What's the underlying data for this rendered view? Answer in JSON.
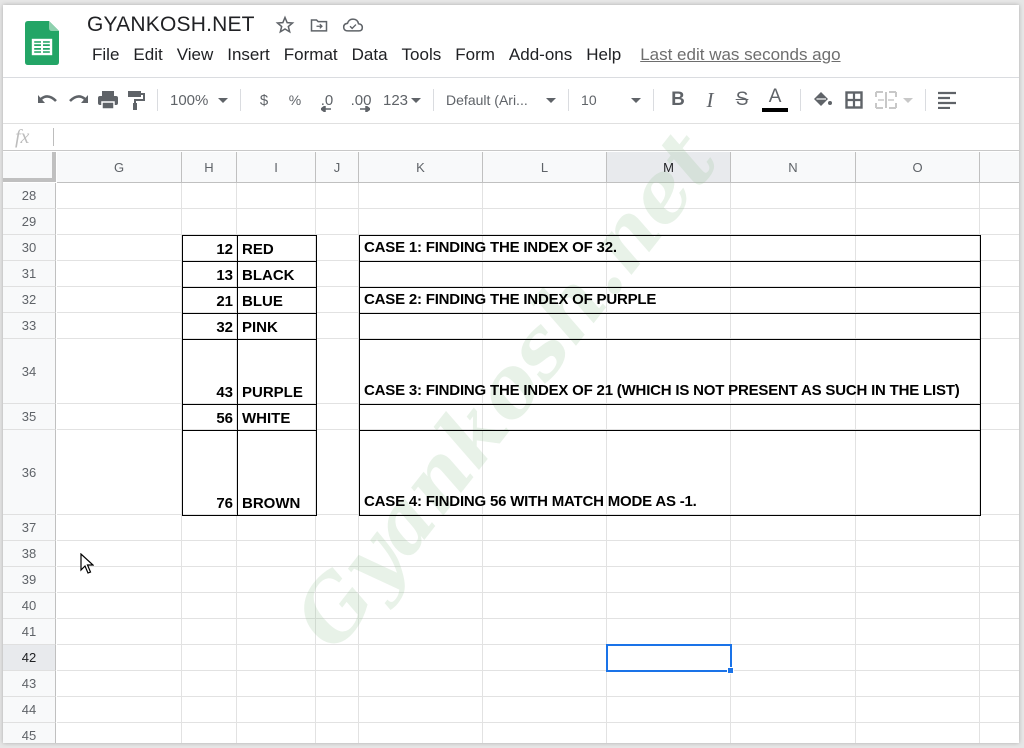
{
  "app": {
    "title": "GYANKOSH.NET",
    "title_icons": [
      "star-icon",
      "move-to-folder-icon",
      "cloud-saved-icon"
    ],
    "menu": [
      "File",
      "Edit",
      "View",
      "Insert",
      "Format",
      "Data",
      "Tools",
      "Form",
      "Add-ons",
      "Help"
    ],
    "last_edit": "Last edit was seconds ago"
  },
  "toolbar": {
    "zoom": "100%",
    "currency": "$",
    "percent": "%",
    "decrease_decimal": ".0",
    "increase_decimal": ".00",
    "more_formats": "123",
    "font": "Default (Ari...",
    "font_size": "10",
    "bold": "B",
    "italic": "I",
    "strikethrough": "S",
    "text_color": "A",
    "text_color_value": "#000000"
  },
  "formula_bar": {
    "icon": "fx",
    "value": ""
  },
  "columns": [
    "G",
    "H",
    "I",
    "J",
    "K",
    "L",
    "M",
    "N",
    "O"
  ],
  "active_column": "M",
  "rows": [
    "28",
    "29",
    "30",
    "31",
    "32",
    "33",
    "34",
    "35",
    "36",
    "37",
    "38",
    "39",
    "40",
    "41",
    "42",
    "43",
    "44",
    "45"
  ],
  "active_row": "42",
  "selected_cell": "M42",
  "list_table": [
    {
      "row": "30",
      "number": "12",
      "color": "RED"
    },
    {
      "row": "31",
      "number": "13",
      "color": "BLACK"
    },
    {
      "row": "32",
      "number": "21",
      "color": "BLUE"
    },
    {
      "row": "33",
      "number": "32",
      "color": "PINK"
    },
    {
      "row": "34",
      "number": "43",
      "color": "PURPLE"
    },
    {
      "row": "35",
      "number": "56",
      "color": "WHITE"
    },
    {
      "row": "36",
      "number": "76",
      "color": "BROWN"
    }
  ],
  "cases": [
    {
      "row": "30",
      "text": "CASE 1: FINDING THE INDEX OF 32."
    },
    {
      "row": "31",
      "text": ""
    },
    {
      "row": "32",
      "text": "CASE 2: FINDING THE INDEX OF PURPLE"
    },
    {
      "row": "33",
      "text": ""
    },
    {
      "row": "34",
      "text": "CASE 3: FINDING THE INDEX OF 21 (WHICH IS NOT PRESENT AS SUCH IN THE LIST)"
    },
    {
      "row": "35",
      "text": ""
    },
    {
      "row": "36",
      "text": "CASE 4: FINDING 56 WITH MATCH MODE AS -1."
    }
  ],
  "watermark": "Gyankosh.net",
  "colors": {
    "brand_green": "#23a566",
    "selection_blue": "#1a73e8"
  }
}
